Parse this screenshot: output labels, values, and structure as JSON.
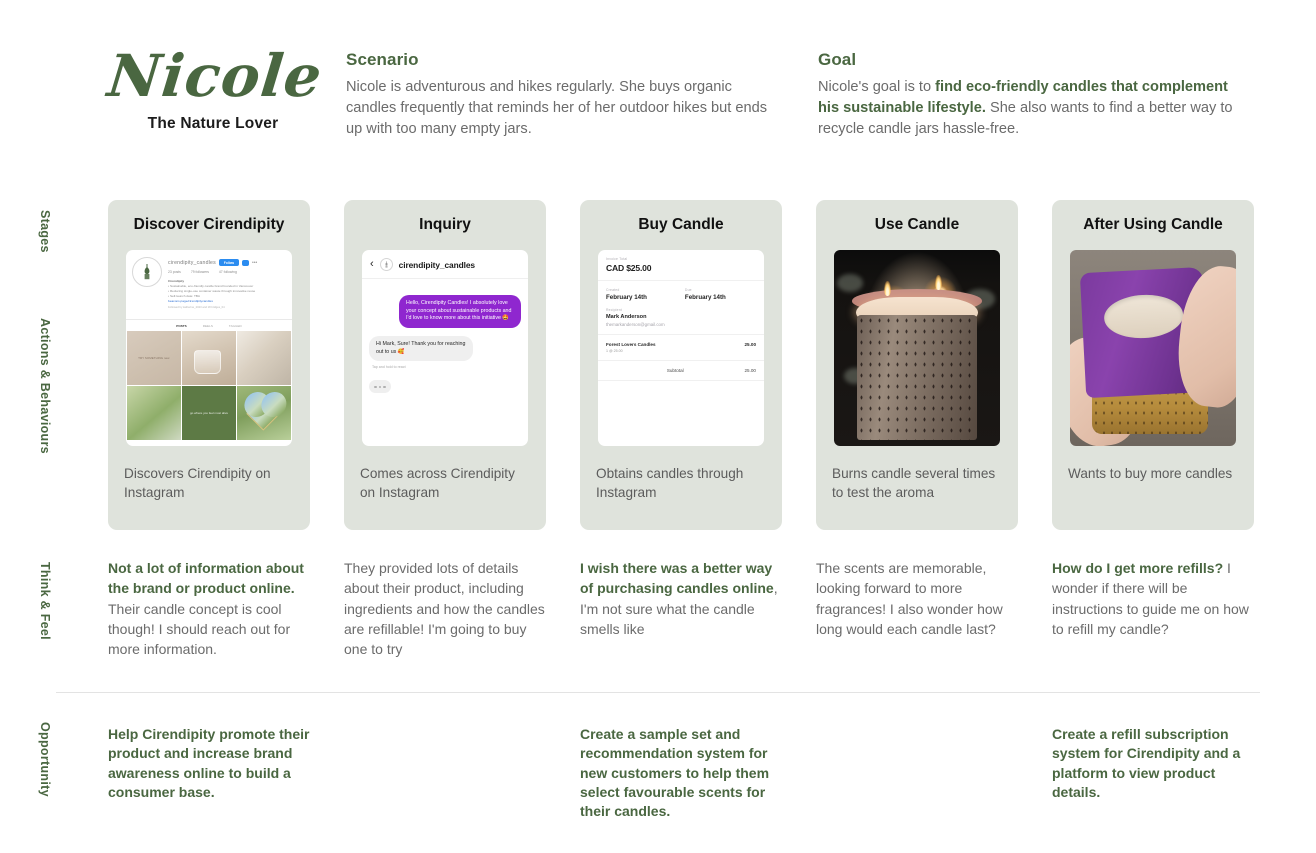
{
  "persona": {
    "name": "Nicole",
    "tagline": "The Nature Lover"
  },
  "scenario": {
    "heading": "Scenario",
    "body": "Nicole is adventurous and hikes regularly. She buys organic candles frequently that reminds her of her outdoor hikes but ends up with too many empty jars."
  },
  "goal": {
    "heading": "Goal",
    "lead": "Nicole's goal is to ",
    "emphasis": "find eco-friendly candles that complement his sustainable lifestyle.",
    "tail": " She also wants to find a better way to recycle candle jars hassle-free."
  },
  "row_labels": {
    "stages": "Stages",
    "actions": "Actions & Behaviours",
    "think": "Think & Feel",
    "opportunity": "Opportunity"
  },
  "stages": [
    {
      "title": "Discover Cirendipity",
      "caption": "Discovers Cirendipity on Instagram"
    },
    {
      "title": "Inquiry",
      "caption": "Comes across Cirendipity on Instagram"
    },
    {
      "title": "Buy Candle",
      "caption": "Obtains candles through Instagram"
    },
    {
      "title": "Use Candle",
      "caption": "Burns candle several times to test the aroma"
    },
    {
      "title": "After Using Candle",
      "caption": "Wants to buy more candles"
    }
  ],
  "instagram": {
    "handle": "cirendipity_candles",
    "follow_label": "Follow",
    "posts": "23 posts",
    "followers": "79 followers",
    "following": "47 following",
    "bio_name": "Cirendipity",
    "bio_line1": "• Sustainable, eco-friendly candle brand founded in Vancouver",
    "bio_line2": "• Reducing single-use container waste through innovative reuse",
    "bio_line3": "• Self-launch date: TBA",
    "bio_link": "beacons.page/cirendipitycandles",
    "followed_by": "Followed by katherine_2023 and 18 bridges_04",
    "tab_posts": "POSTS",
    "tab_reels": "REELS",
    "tab_tagged": "TAGGED",
    "tile1_text": "TRY SOMETHING new",
    "tile5_text": "go where you feel most alive"
  },
  "dm": {
    "back_icon": "chevron-left-icon",
    "name": "cirendipity_candles",
    "outgoing": "Hello, Cirendipity Candles! I absolutely love your concept about sustainable products and I'd love to know more about this initiative 🤩",
    "incoming": "Hi Mark, Sure! Thank you for reaching out to us 🥰",
    "hint": "Tap and hold to react"
  },
  "invoice": {
    "total_label": "Invoice Total",
    "total_value": "CAD $25.00",
    "created_label": "Created",
    "created_value": "February 14th",
    "due_label": "Due",
    "due_value": "February 14th",
    "recipient_label": "Recipient",
    "recipient_name": "Mark Anderson",
    "recipient_email": "themarkanderson@gmail.com",
    "item_name": "Forest Lovers Candles",
    "item_qty": "1 @ 25.00",
    "item_price": "25.00",
    "subtotal_label": "Subtotal",
    "subtotal_value": "25.00"
  },
  "think_feel": [
    {
      "emphasis": "Not a lot of information about the brand or product online.",
      "rest": " Their candle concept is cool though! I should reach out for more information."
    },
    {
      "emphasis": "",
      "rest": "They provided lots of details about their product, including ingredients and how the candles are refillable! I'm going to buy one to try"
    },
    {
      "emphasis": "I wish there was a better way of purchasing candles online",
      "rest": ", I'm not sure what the candle smells like"
    },
    {
      "emphasis": "",
      "rest": "The scents are memorable, looking forward to more fragrances! I also wonder how long would each candle last?"
    },
    {
      "emphasis": "How do I get more refills?",
      "rest": " I wonder if there will be instructions to guide me on how to refill my candle?"
    }
  ],
  "opportunities": [
    "Help Cirendipity promote their product and increase brand awareness online to build a consumer base.",
    "",
    "Create a sample set and recommendation system for new customers to help them select favourable scents for their candles.",
    "",
    "Create a refill subscription system for Cirendipity and a platform to view product details."
  ],
  "colors": {
    "brand_green": "#4a6741",
    "card_bg": "#dfe3dc",
    "body_text": "#6b6b6b",
    "instagram_blue": "#2b8cf0",
    "dm_purple": "#8f27cf"
  }
}
